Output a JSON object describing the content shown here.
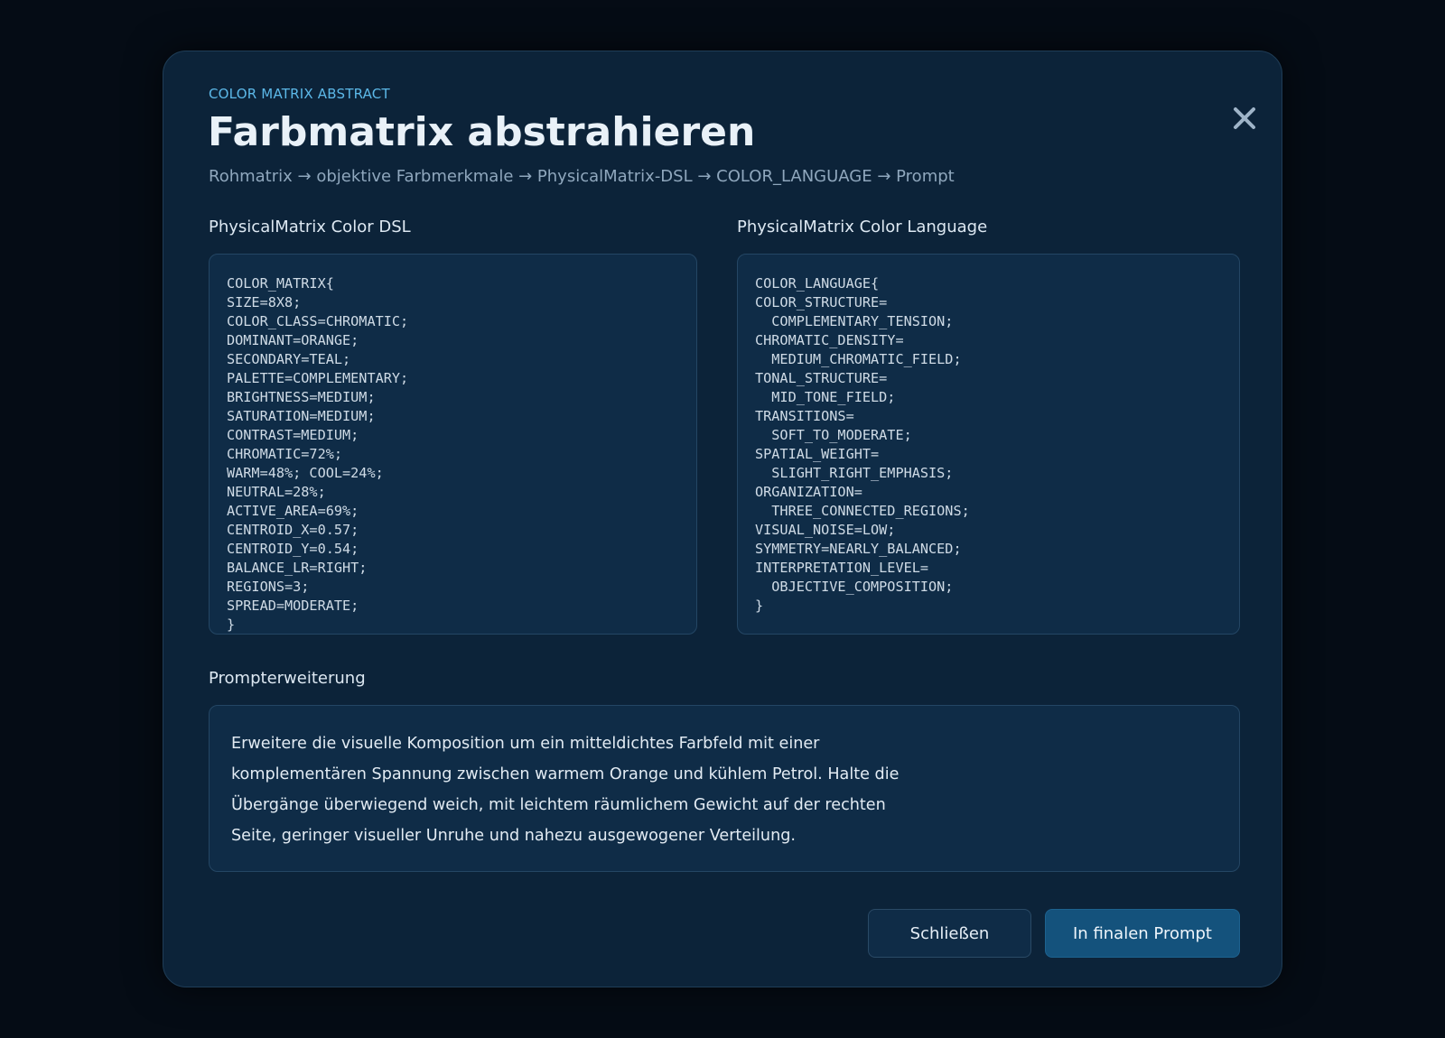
{
  "dialog": {
    "eyebrow": "COLOR MATRIX ABSTRACT",
    "title": "Farbmatrix abstrahieren",
    "subtitle": "Rohmatrix → objektive Farbmerkmale → PhysicalMatrix-DSL → COLOR_LANGUAGE → Prompt",
    "close_icon": "close-icon"
  },
  "dsl_panel": {
    "label": "PhysicalMatrix Color DSL",
    "code": "COLOR_MATRIX{\nSIZE=8X8;\nCOLOR_CLASS=CHROMATIC;\nDOMINANT=ORANGE;\nSECONDARY=TEAL;\nPALETTE=COMPLEMENTARY;\nBRIGHTNESS=MEDIUM;\nSATURATION=MEDIUM;\nCONTRAST=MEDIUM;\nCHROMATIC=72%;\nWARM=48%; COOL=24%;\nNEUTRAL=28%;\nACTIVE_AREA=69%;\nCENTROID_X=0.57;\nCENTROID_Y=0.54;\nBALANCE_LR=RIGHT;\nREGIONS=3;\nSPREAD=MODERATE;\n}"
  },
  "language_panel": {
    "label": "PhysicalMatrix Color Language",
    "code": "COLOR_LANGUAGE{\nCOLOR_STRUCTURE=\n  COMPLEMENTARY_TENSION;\nCHROMATIC_DENSITY=\n  MEDIUM_CHROMATIC_FIELD;\nTONAL_STRUCTURE=\n  MID_TONE_FIELD;\nTRANSITIONS=\n  SOFT_TO_MODERATE;\nSPATIAL_WEIGHT=\n  SLIGHT_RIGHT_EMPHASIS;\nORGANIZATION=\n  THREE_CONNECTED_REGIONS;\nVISUAL_NOISE=LOW;\nSYMMETRY=NEARLY_BALANCED;\nINTERPRETATION_LEVEL=\n  OBJECTIVE_COMPOSITION;\n}"
  },
  "prompt_section": {
    "label": "Prompterweiterung",
    "text": "Erweitere die visuelle Komposition um ein mitteldichtes Farbfeld mit einer komplementären Spannung zwischen warmem Orange und kühlem Petrol. Halte die Übergänge überwiegend weich, mit leichtem räumlichem Gewicht auf der rechten Seite, geringer visueller Unruhe und nahezu ausgewogener Verteilung."
  },
  "actions": {
    "close_label": "Schließen",
    "apply_label": "In finalen Prompt"
  },
  "colors": {
    "backdrop": "#050c15",
    "dialog_bg": "#0c2339",
    "panel_bg": "#0f2c47",
    "accent": "#5cb8e8",
    "primary_button": "#14527c"
  }
}
